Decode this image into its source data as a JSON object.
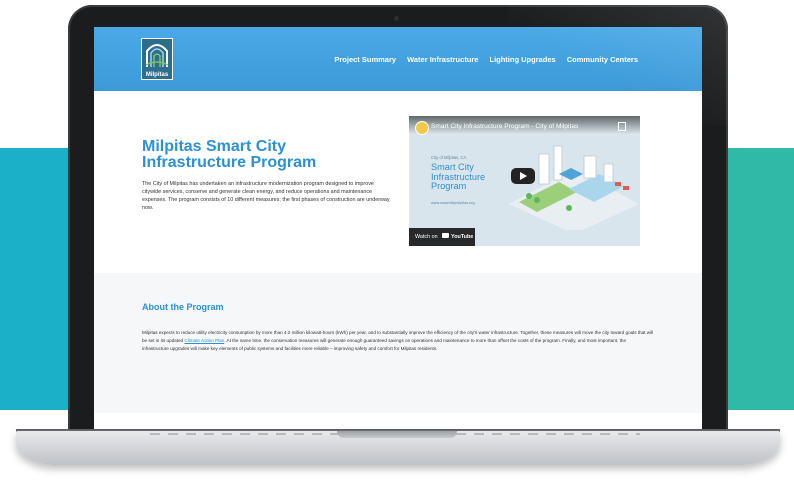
{
  "colors": {
    "accent": "#2b91d3",
    "header": "#3ea0e0",
    "bg_left": "#1ab0c8",
    "bg_right": "#2fbaa5"
  },
  "site": {
    "logo_text": "Milpitas",
    "nav": [
      "Project Summary",
      "Water Infrastructure",
      "Lighting Upgrades",
      "Community Centers"
    ]
  },
  "hero": {
    "title": "Milpitas Smart City Infrastructure Program",
    "description": "The City of Milpitas has undertaken an infrastructure modernization program designed to improve citywide services, conserve and generate clean energy, and reduce operations and maintenance expenses. The program consists of 10 different measures; the first phases of construction are underway now."
  },
  "video": {
    "title": "Smart City Infrastructure Program - City of Milpitas",
    "small_label": "City of Milpitas, CA",
    "heading": "Smart City Infrastructure Program",
    "url": "www.smartcitymilpitas.org",
    "watch_label": "Watch on",
    "youtube_label": "YouTube"
  },
  "about": {
    "title": "About the Program",
    "text_before": "Milpitas expects to reduce utility electricity consumption by more than 4.2 million kilowatt-hours (kWh) per year, and to substantially improve the efficiency of the city's water infrastructure. Together, these measures will move the city toward goals that will be set in its updated ",
    "link": "Climate Action Plan",
    "text_after": ". At the same time, the conservation measures will generate enough guaranteed savings on operations and maintenance to more than offset the costs of the program. Finally, and most important, the infrastructure upgrades will make key elements of public systems and facilities more reliable – improving safety and comfort for Milpitas residents."
  }
}
